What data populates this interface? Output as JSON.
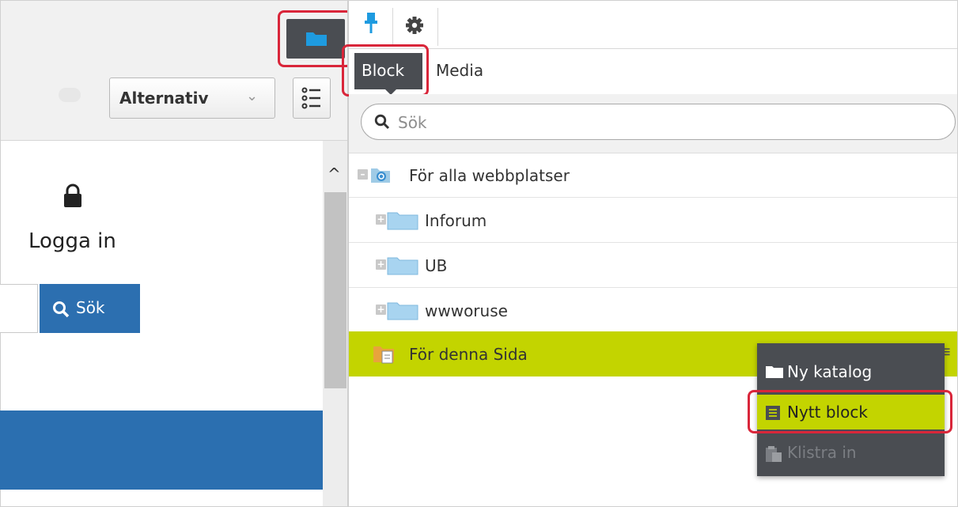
{
  "left": {
    "options_select": "Alternativ",
    "login_label": "Logga in",
    "search_button": "Sök"
  },
  "right": {
    "tabs": {
      "block": "Block",
      "media": "Media"
    },
    "search_placeholder": "Sök",
    "tree": [
      {
        "label": "För alla webbplatser",
        "icon": "global-folder-icon"
      },
      {
        "label": "Inforum",
        "icon": "folder-icon"
      },
      {
        "label": "UB",
        "icon": "folder-icon"
      },
      {
        "label": "wwworuse",
        "icon": "folder-icon"
      },
      {
        "label": "För denna Sida",
        "icon": "page-folder-icon",
        "selected": true
      }
    ],
    "context_menu": [
      {
        "label": "Ny katalog",
        "icon": "folder-icon"
      },
      {
        "label": "Nytt block",
        "icon": "block-icon",
        "highlighted": true
      },
      {
        "label": "Klistra in",
        "icon": "paste-icon",
        "disabled": true
      }
    ]
  },
  "colors": {
    "accent_green": "#c3d400",
    "dark_panel": "#4a4d52",
    "primary_blue": "#2c6fb0",
    "annotation_red": "#d9263a"
  }
}
